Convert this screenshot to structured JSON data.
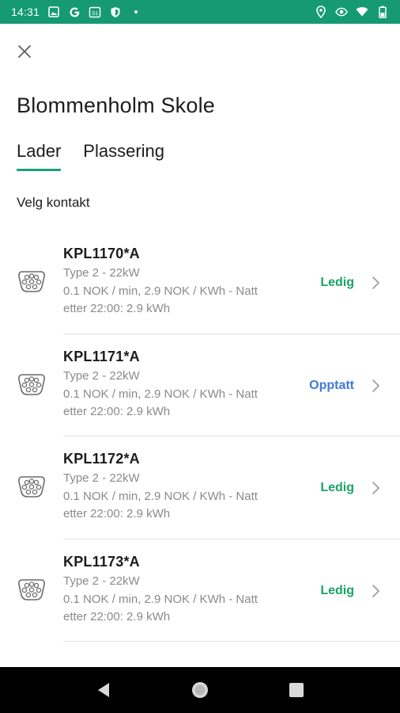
{
  "status_bar": {
    "time": "14:31",
    "left_icons": [
      "image-icon",
      "google-icon",
      "calendar-icon",
      "shield-icon",
      "dot-icon"
    ],
    "calendar_day": "31",
    "right_icons": [
      "location-icon",
      "eye-icon",
      "wifi-icon",
      "battery-icon"
    ]
  },
  "header": {
    "close_icon": "close-icon",
    "title": "Blommenholm Skole"
  },
  "tabs": [
    {
      "label": "Lader",
      "active": true
    },
    {
      "label": "Plassering",
      "active": false
    }
  ],
  "section_label": "Velg kontakt",
  "connectors": [
    {
      "name": "KPL1170*A",
      "type": "Type 2 - 22kW",
      "price_line1": "0.1 NOK / min, 2.9 NOK / KWh - Natt",
      "price_line2": "etter 22:00: 2.9 kWh",
      "status": "Ledig",
      "status_kind": "free"
    },
    {
      "name": "KPL1171*A",
      "type": "Type 2 - 22kW",
      "price_line1": "0.1 NOK / min, 2.9 NOK / KWh - Natt",
      "price_line2": "etter 22:00: 2.9 kWh",
      "status": "Opptatt",
      "status_kind": "busy"
    },
    {
      "name": "KPL1172*A",
      "type": "Type 2 - 22kW",
      "price_line1": "0.1 NOK / min, 2.9 NOK / KWh - Natt",
      "price_line2": "etter 22:00: 2.9 kWh",
      "status": "Ledig",
      "status_kind": "free"
    },
    {
      "name": "KPL1173*A",
      "type": "Type 2 - 22kW",
      "price_line1": "0.1 NOK / min, 2.9 NOK / KWh - Natt",
      "price_line2": "etter 22:00: 2.9 kWh",
      "status": "Ledig",
      "status_kind": "free"
    }
  ],
  "colors": {
    "status_bar": "#159a73",
    "accent": "#1aa17a",
    "free": "#19a463",
    "busy": "#3f7ad6"
  },
  "nav_bar": {
    "buttons": [
      "back-icon",
      "home-icon",
      "recents-icon"
    ]
  }
}
